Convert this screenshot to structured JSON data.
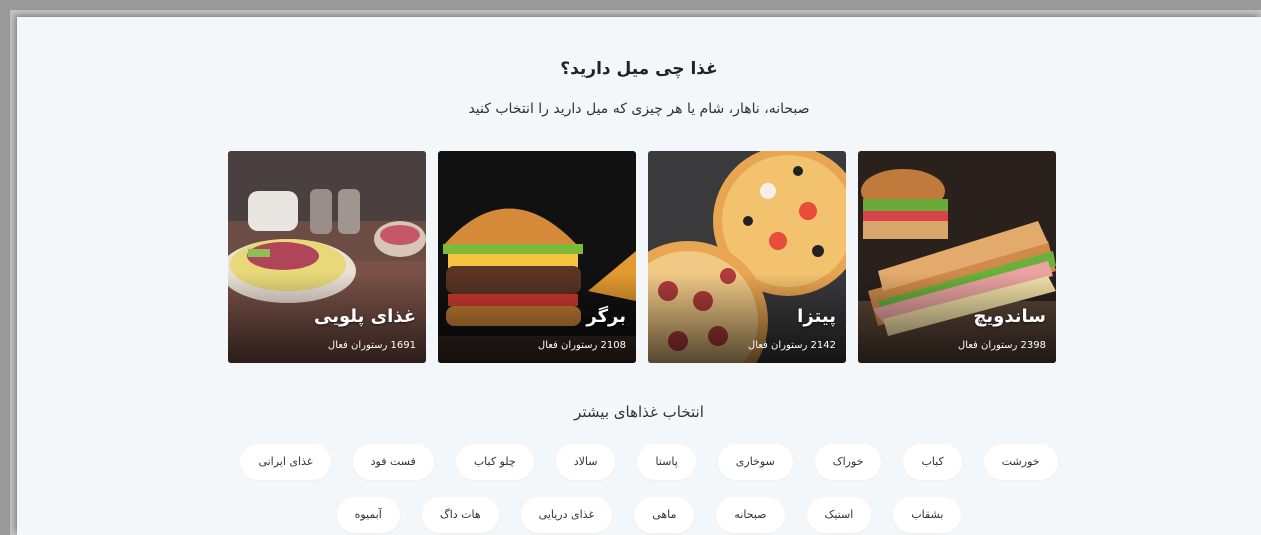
{
  "heading": {
    "title": "غذا چی میل دارید؟",
    "subtitle": "صبحانه، ناهار، شام یا هر چیزی که میل دارید را انتخاب کنید"
  },
  "categories": [
    {
      "name": "ساندویچ",
      "count": "2398 رستوران فعال",
      "image": "sandwich-image"
    },
    {
      "name": "پیتزا",
      "count": "2142 رستوران فعال",
      "image": "pizza-image"
    },
    {
      "name": "برگر",
      "count": "2108 رستوران فعال",
      "image": "burger-image"
    },
    {
      "name": "غذای پلویی",
      "count": "1691 رستوران فعال",
      "image": "rice-dish-image"
    }
  ],
  "more": {
    "title": "انتخاب غذاهای بیشتر",
    "row1": [
      "خورشت",
      "کباب",
      "خوراک",
      "سوخاری",
      "پاستا",
      "سالاد",
      "چلو کباب",
      "فست فود",
      "غذای ایرانی"
    ],
    "row2": [
      "بشقاب",
      "استیک",
      "صبحانه",
      "ماهی",
      "غذای دریایی",
      "هات داگ",
      "آبمیوه"
    ]
  }
}
